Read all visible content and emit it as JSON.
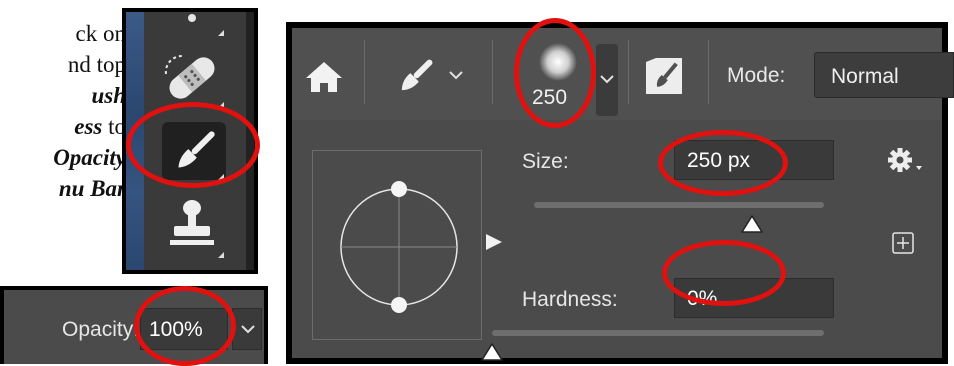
{
  "instructions": {
    "line1": "ck on",
    "line2": "nd top",
    "line3": "ush",
    "line4_em": "ess",
    "line4_rest": " to",
    "line5": "Opacity",
    "line6": "nu Bar"
  },
  "options_bar": {
    "brush_preset_size": "250",
    "mode_label": "Mode:",
    "mode_value": "Normal"
  },
  "brush_panel": {
    "size_label": "Size:",
    "size_value": "250 px",
    "hardness_label": "Hardness:",
    "hardness_value": "0%",
    "size_slider_fraction": 0.75,
    "hardness_slider_fraction": 0.0
  },
  "opacity": {
    "label": "Opacity:",
    "value": "100%"
  },
  "colors": {
    "highlight": "#e0110e",
    "panel": "#4b4b4b",
    "field": "#3a3a3a"
  },
  "icons": [
    "home-icon",
    "brush-icon",
    "chevron-down-icon",
    "brush-settings-icon",
    "gear-icon",
    "new-preset-icon",
    "bandage-icon",
    "stamp-icon"
  ]
}
